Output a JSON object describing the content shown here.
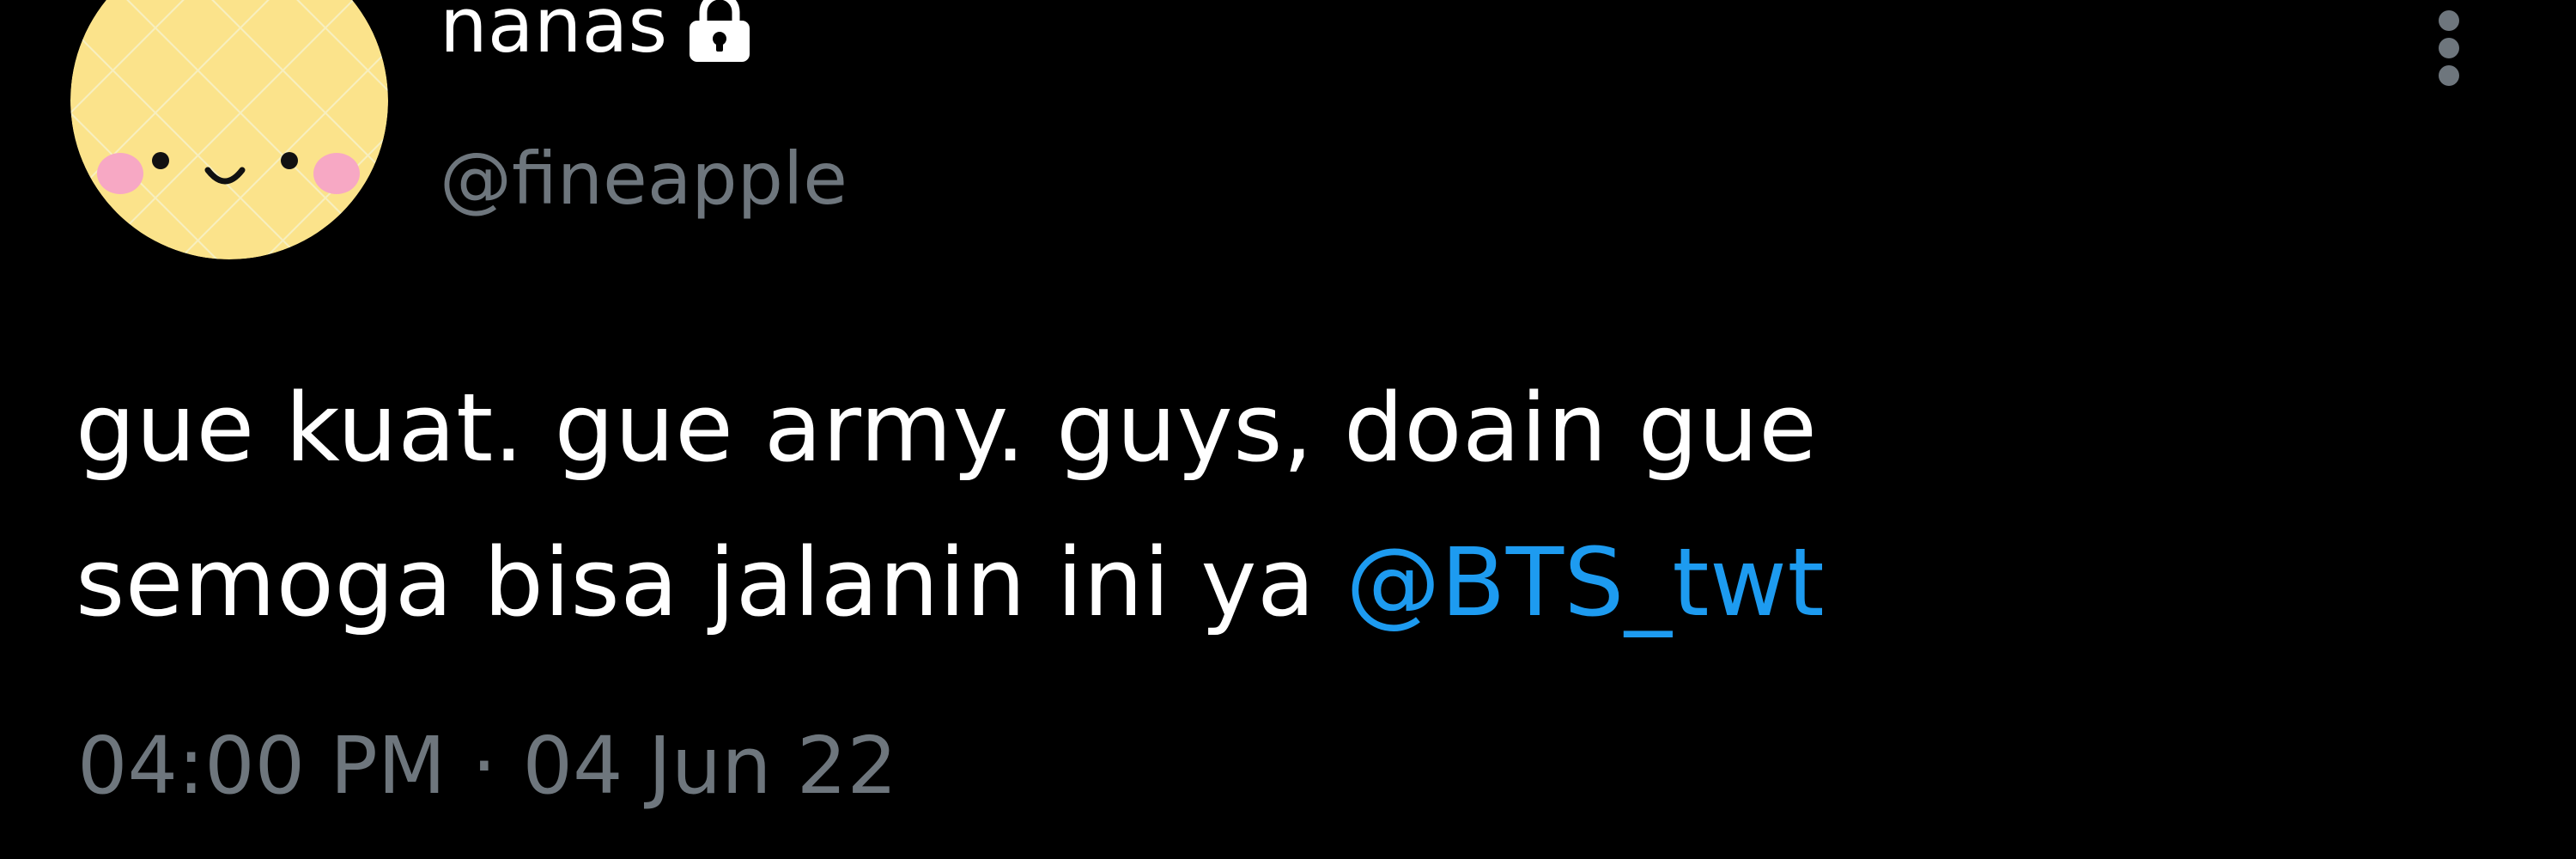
{
  "tweet": {
    "author": {
      "display_name": "nanas",
      "handle": "@fineapple",
      "protected_icon": "lock-icon",
      "avatar_icon": "smiling-pineapple-avatar"
    },
    "more_icon": "more-vertical-icon",
    "text": {
      "line1": "gue kuat. gue army. guys, doain gue",
      "line2_prefix": "semoga bisa jalanin ini ya ",
      "mention": "@BTS_twt"
    },
    "time": "04:00 PM",
    "separator": "·",
    "date": "04 Jun 22"
  },
  "colors": {
    "background": "#000000",
    "text_primary": "#ffffff",
    "text_secondary": "#6e767d",
    "link": "#1d9bf0",
    "avatar_fill": "#fbe38b",
    "avatar_cheeks": "#f7a8c4"
  }
}
